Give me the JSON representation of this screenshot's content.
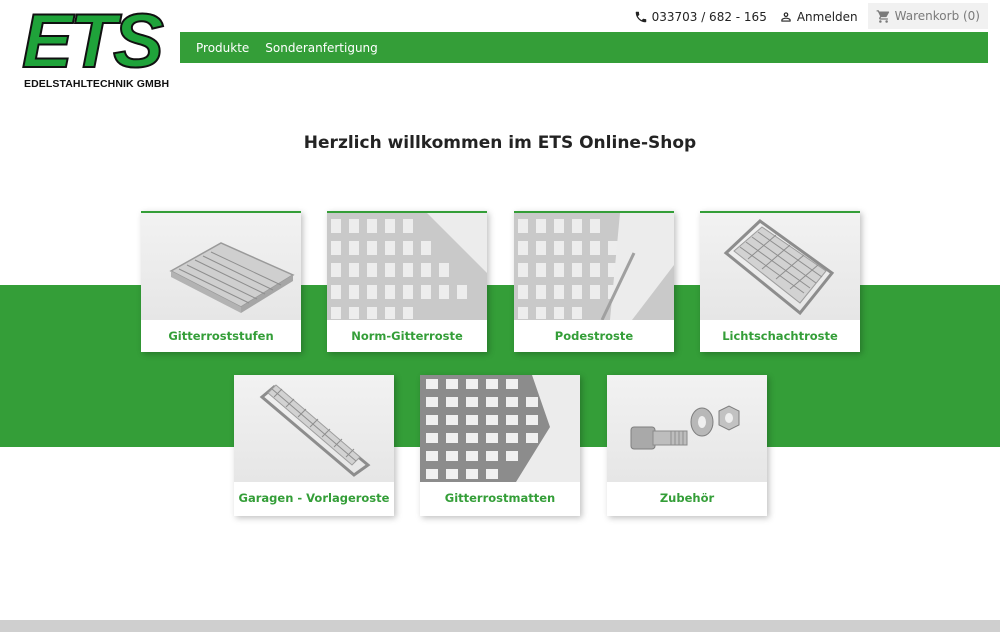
{
  "logo": {
    "brand": "ETS",
    "subtitle": "EDELSTAHLTECHNIK GMBH"
  },
  "topbar": {
    "phone": "033703 / 682 - 165",
    "login": "Anmelden",
    "cart": "Warenkorb (0)"
  },
  "nav": {
    "items": [
      "Produkte",
      "Sonderanfertigung"
    ]
  },
  "colors": {
    "brand_green": "#349e38",
    "text": "#232323"
  },
  "main": {
    "heading": "Herzlich willkommen im ETS Online-Shop"
  },
  "categories": [
    {
      "label": "Gitterroststufen",
      "icon": "stair-tread-grating"
    },
    {
      "label": "Norm-Gitterroste",
      "icon": "standard-grating"
    },
    {
      "label": "Podestroste",
      "icon": "platform-grating"
    },
    {
      "label": "Lichtschachtroste",
      "icon": "light-well-grating"
    },
    {
      "label": "Garagen - Vorlageroste",
      "icon": "garage-grating"
    },
    {
      "label": "Gitterrostmatten",
      "icon": "grating-mat"
    },
    {
      "label": "Zubehör",
      "icon": "bolt-nut-washer"
    }
  ]
}
